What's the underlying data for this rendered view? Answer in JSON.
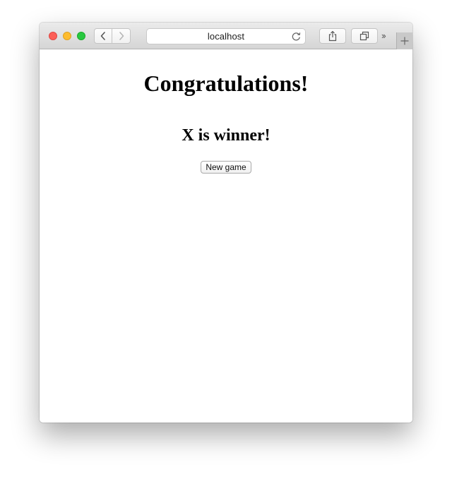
{
  "browser": {
    "address": "localhost"
  },
  "page": {
    "headline": "Congratulations!",
    "winner_text": "X is winner!",
    "new_game_label": "New game"
  },
  "icons": {
    "back": "chevron-left-icon",
    "forward": "chevron-right-icon",
    "reload": "reload-icon",
    "share": "share-icon",
    "tabs": "tabs-overview-icon",
    "more": "double-chevron-right-icon",
    "new_tab": "plus-icon"
  },
  "colors": {
    "close": "#fc5f57",
    "minimize": "#fdbc2e",
    "zoom": "#28c840"
  }
}
